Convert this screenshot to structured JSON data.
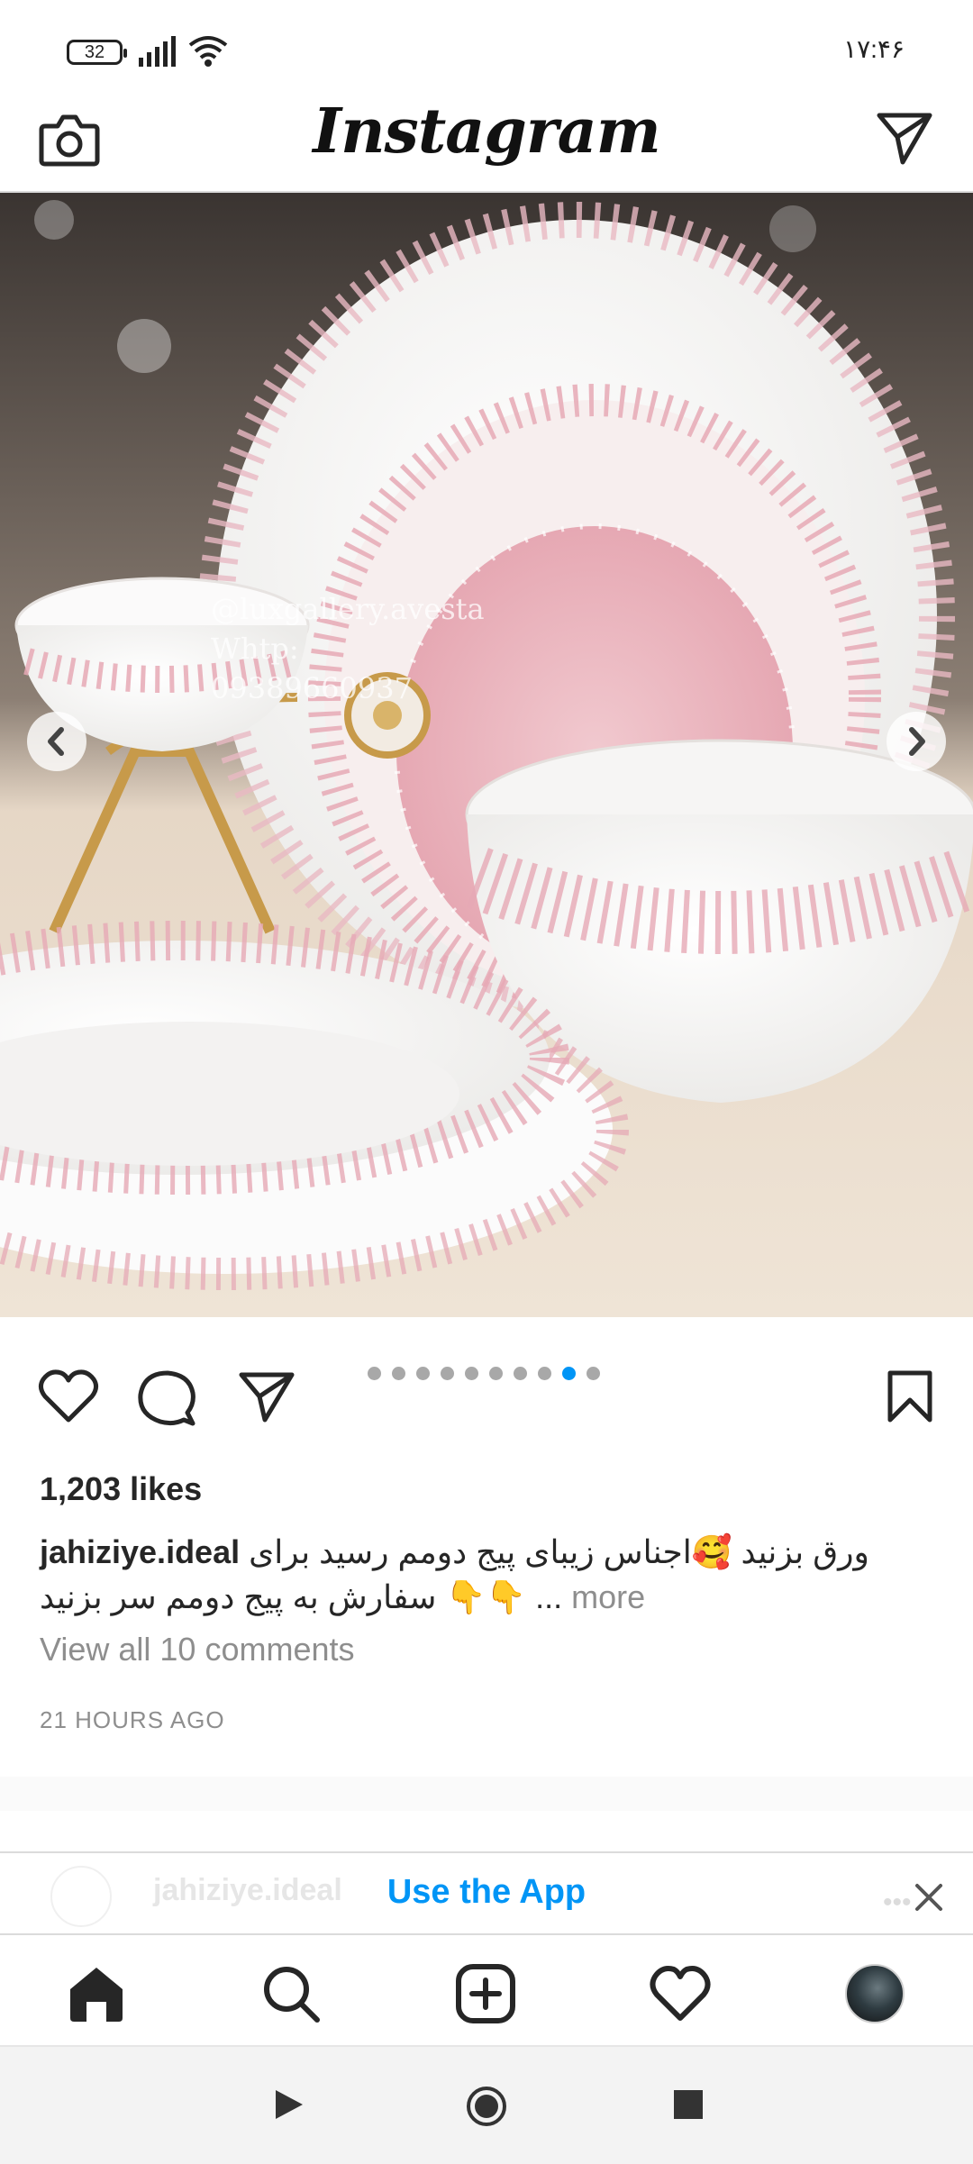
{
  "status_bar": {
    "battery": "32",
    "time": "۱۷:۴۶"
  },
  "header": {
    "logo": "Instagram"
  },
  "post": {
    "watermark": {
      "line1": "@luxgallery.avesta",
      "line2": "Whtp:",
      "line3": "09389660937"
    },
    "carousel": {
      "total": 10,
      "active_index": 8
    },
    "likes": "1,203 likes",
    "username": "jahiziye.ideal",
    "caption_line1": "ورق بزنید 🥰اجناس زیبای پیج دومم رسید برای",
    "caption_line2": "سفارش به پیج دومم سر بزنید 👇👇 ...",
    "more_label": "more",
    "view_comments": "View all 10 comments",
    "time_ago": "21 HOURS AGO"
  },
  "next_post": {
    "username": "jahiziye.ideal"
  },
  "banner": {
    "use_app": "Use the App"
  },
  "colors": {
    "link_blue": "#0095f6",
    "muted_gray": "#8e8e8e",
    "divider": "#dbdbdb",
    "text": "#262626"
  },
  "icons": {
    "header": [
      "camera-icon",
      "direct-message-icon"
    ],
    "post_actions": [
      "heart-icon",
      "comment-icon",
      "share-icon",
      "bookmark-icon"
    ],
    "bottom_nav": [
      "home-icon",
      "search-icon",
      "create-icon",
      "activity-heart-icon",
      "profile-avatar"
    ],
    "system_nav": [
      "back-triangle-icon",
      "home-circle-icon",
      "recents-square-icon"
    ]
  }
}
